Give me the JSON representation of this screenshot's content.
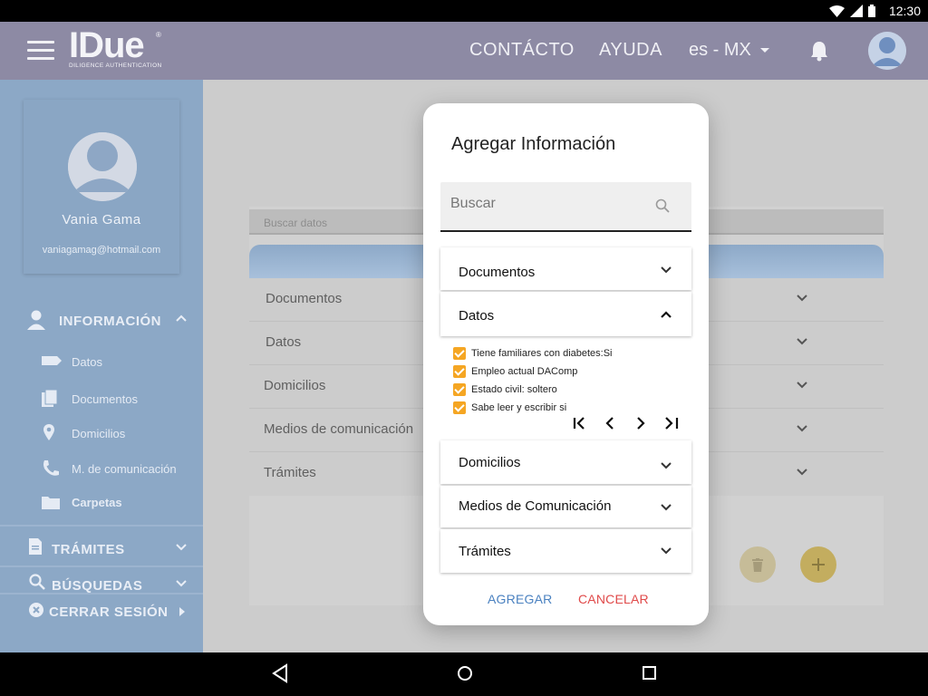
{
  "status_bar": {
    "time": "12:30"
  },
  "app_bar": {
    "logo_text": "IDue",
    "logo_tagline": "DILIGENCE AUTHENTICATION",
    "nav_contact": "CONTÁCTO",
    "nav_help": "AYUDA",
    "language": "es - MX"
  },
  "sidebar": {
    "profile_name": "Vania Gama",
    "profile_email": "vaniagamag@hotmail.com",
    "info_section": "INFORMACIÓN",
    "info_items": [
      "Datos",
      "Documentos",
      "Domicilios",
      "M. de comunicación",
      "Carpetas"
    ],
    "tramites_section": "TRÁMITES",
    "busquedas_section": "BÚSQUEDAS",
    "logout": "CERRAR SESIÓN"
  },
  "main": {
    "search_placeholder": "Buscar datos",
    "rows": [
      "Documentos",
      "Datos",
      "Domicilios",
      "Medios de comunicación",
      "Trámites"
    ]
  },
  "dialog": {
    "title": "Agregar Información",
    "search_placeholder": "Buscar",
    "sections": [
      "Documentos",
      "Datos",
      "Domicilios",
      "Medios de Comunicación",
      "Trámites"
    ],
    "expanded_section": "Datos",
    "checked_items": [
      "Tiene familiares con diabetes:Si",
      "Empleo actual DAComp",
      "Estado civil: soltero",
      "Sabe leer y escribir si"
    ],
    "add_button": "AGREGAR",
    "cancel_button": "CANCELAR"
  },
  "colors": {
    "appbar": "#8d8aa4",
    "sidebar": "#8ca8c6",
    "checkbox": "#f5a623",
    "add_button": "#4a81c0",
    "cancel_button": "#e04a4a",
    "fab_add": "#c3ad5f"
  },
  "icons": {
    "status": [
      "wifi-icon",
      "signal-icon",
      "battery-icon"
    ],
    "appbar": [
      "menu-icon",
      "bell-icon",
      "avatar-icon"
    ],
    "sidebar": [
      "person-icon",
      "label-icon",
      "document-icon",
      "location-icon",
      "phone-icon",
      "folder-icon",
      "file-icon",
      "search-icon",
      "close-circle-icon"
    ],
    "navbar": [
      "back-icon",
      "home-icon",
      "recents-icon"
    ]
  }
}
